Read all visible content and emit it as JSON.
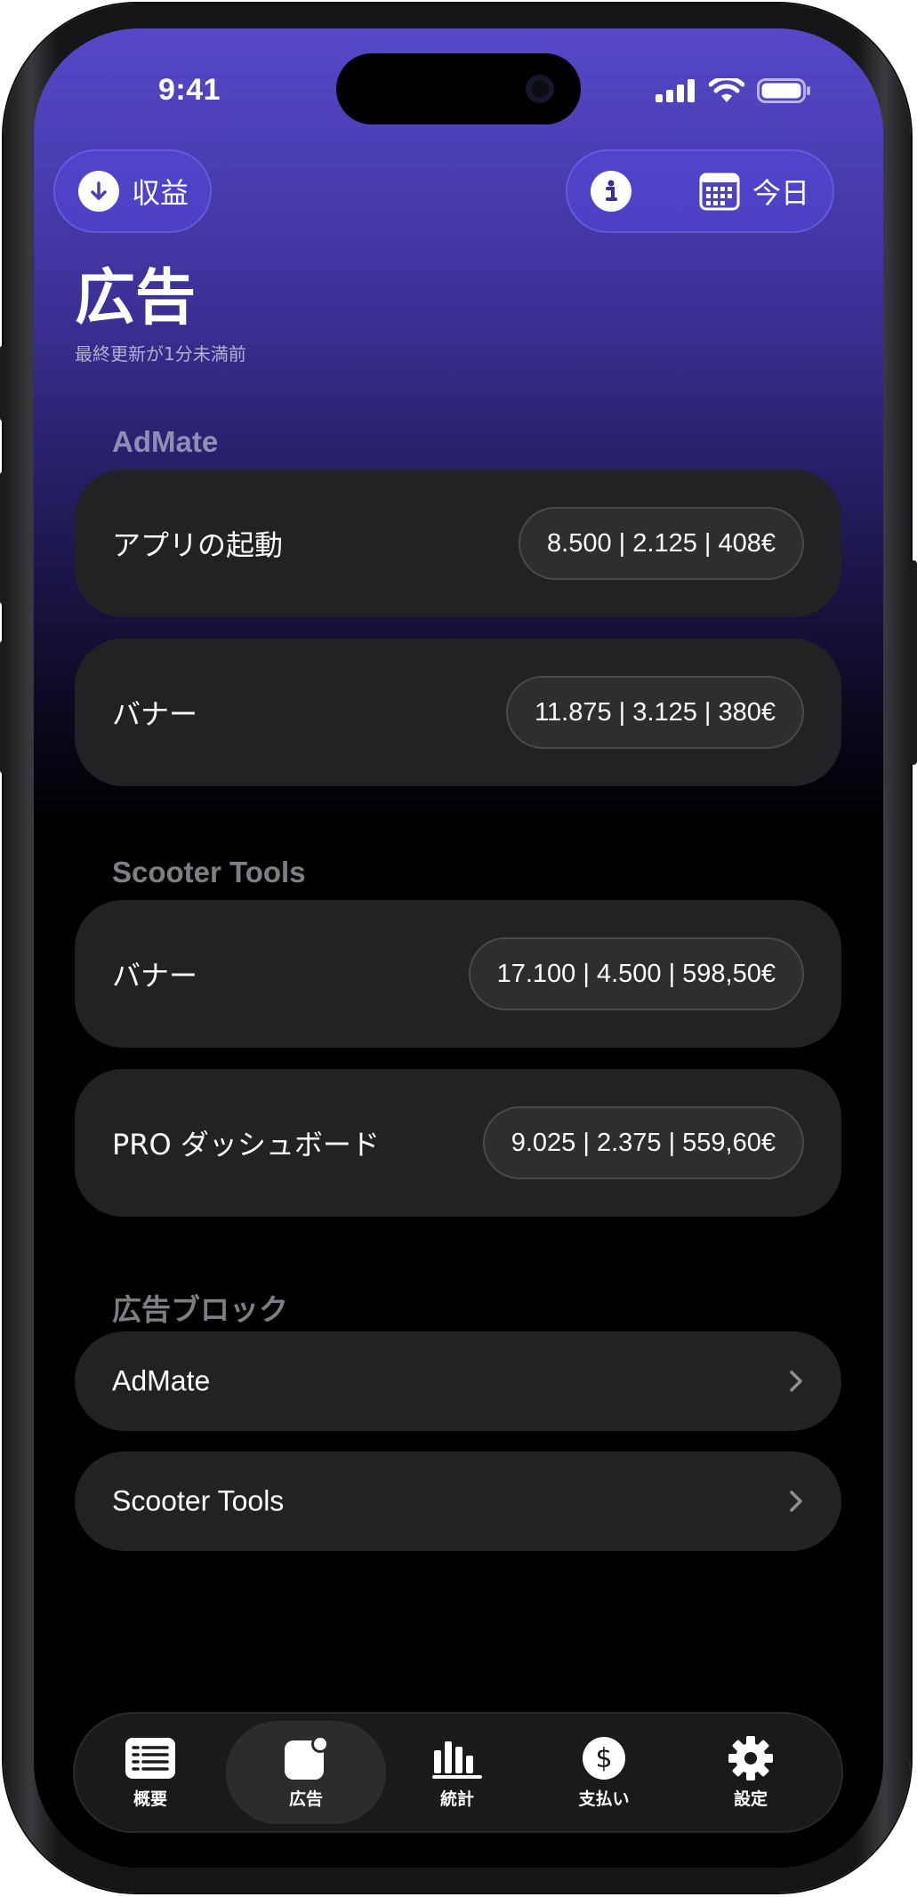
{
  "status_bar": {
    "time": "9:41"
  },
  "header": {
    "earnings_button_label": "収益",
    "date_button_label": "今日",
    "title": "広告",
    "last_updated": "最終更新が1分未満前"
  },
  "sections": [
    {
      "title": "AdMate",
      "items": [
        {
          "label": "アプリの起動",
          "stats": "8.500 | 2.125 | 408€"
        },
        {
          "label": "バナー",
          "stats": "11.875 | 3.125 | 380€"
        }
      ]
    },
    {
      "title": "Scooter Tools",
      "items": [
        {
          "label": "バナー",
          "stats": "17.100 | 4.500 | 598,50€"
        },
        {
          "label": "PRO ダッシュボード",
          "stats": "9.025 | 2.375 | 559,60€"
        }
      ]
    }
  ],
  "ad_blocks": {
    "title": "広告ブロック",
    "items": [
      {
        "label": "AdMate"
      },
      {
        "label": "Scooter Tools"
      }
    ]
  },
  "tabbar": {
    "tabs": [
      {
        "label": "概要",
        "icon": "list-icon"
      },
      {
        "label": "広告",
        "icon": "ad-badge-icon",
        "active": true
      },
      {
        "label": "統計",
        "icon": "bar-chart-icon"
      },
      {
        "label": "支払い",
        "icon": "dollar-circle-icon"
      },
      {
        "label": "設定",
        "icon": "gear-icon"
      }
    ]
  },
  "colors": {
    "accent": "#5648c8",
    "card": "#222224",
    "pill_border": "#4a4a4c"
  }
}
